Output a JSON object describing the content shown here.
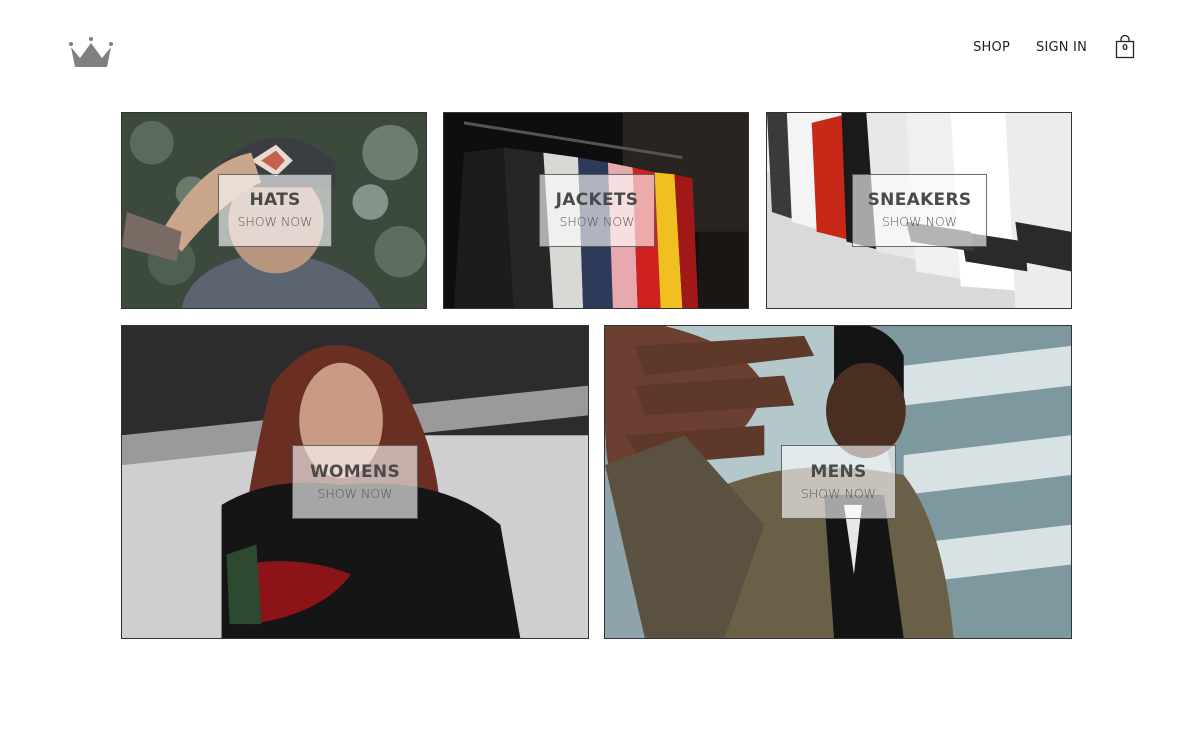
{
  "header": {
    "logo_icon": "crown-icon",
    "nav": {
      "shop_label": "SHOP",
      "signin_label": "SIGN IN"
    },
    "cart": {
      "icon": "shopping-bag-icon",
      "count": "0"
    }
  },
  "directory": {
    "hats": {
      "title": "HATS",
      "subtitle": "SHOW NOW"
    },
    "jackets": {
      "title": "JACKETS",
      "subtitle": "SHOW NOW"
    },
    "sneakers": {
      "title": "SNEAKERS",
      "subtitle": "SHOW NOW"
    },
    "womens": {
      "title": "WOMENS",
      "subtitle": "SHOW NOW"
    },
    "mens": {
      "title": "MENS",
      "subtitle": "SHOW NOW"
    }
  },
  "colors": {
    "text": "#222222",
    "border": "#333333",
    "label_bg": "rgba(255,255,255,0.62)"
  }
}
